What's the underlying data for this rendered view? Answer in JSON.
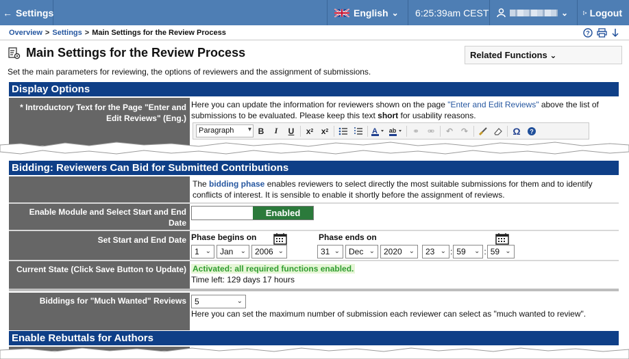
{
  "topbar": {
    "back_label": "Settings",
    "language": "English",
    "time": "6:25:39am",
    "timezone": "CEST",
    "logout_label": "Logout"
  },
  "breadcrumb": {
    "overview": "Overview",
    "settings": "Settings",
    "current": "Main Settings for the Review Process",
    "sep": ">"
  },
  "page": {
    "title": "Main Settings for the Review Process",
    "related_label": "Related Functions",
    "subtitle": "Set the main parameters for reviewing, the options of reviewers and the assignment of submissions."
  },
  "display_options": {
    "header": "Display Options",
    "intro_label": "* Introductory Text for the Page \"Enter and Edit Reviews\" (Eng.)",
    "intro_text_before": "Here you can update the information for reviewers shown on the page ",
    "intro_link": "\"Enter and Edit Reviews\"",
    "intro_text_middle": " above the list of submissions to be evaluated. Please keep this text ",
    "intro_bold": "short",
    "intro_text_after": " for usability reasons.",
    "editor_format": "Paragraph"
  },
  "bidding": {
    "header": "Bidding: Reviewers Can Bid for Submitted Contributions",
    "desc_before": "The ",
    "desc_link": "bidding phase",
    "desc_after": " enables reviewers to select directly the most suitable submissions for them and to identify conflicts of interest. It is sensible to enable it shortly before the assignment of reviews.",
    "enable_label": "Enable Module and Select Start and End Date",
    "enable_state": "Enabled",
    "dates_label": "Set Start and End Date",
    "begins_label": "Phase begins on",
    "ends_label": "Phase ends on",
    "begin": {
      "day": "1",
      "month": "Jan",
      "year": "2006"
    },
    "end": {
      "day": "31",
      "month": "Dec",
      "year": "2020",
      "hour": "23",
      "minute": "59",
      "second": "59"
    },
    "time_sep": ":",
    "state_label": "Current State (Click Save Button to Update)",
    "state_value": "Activated: all required functions enabled.",
    "time_left": "Time left: 129 days 17 hours",
    "much_wanted_label": "Biddings for \"Much Wanted\" Reviews",
    "much_wanted_value": "5",
    "much_wanted_help": "Here you can set the maximum number of submission each reviewer can select as \"much wanted to review\"."
  },
  "rebuttals": {
    "header": "Enable Rebuttals for Authors"
  },
  "colors": {
    "topbar": "#4e7eb4",
    "section_header": "#0f3f87",
    "label_bg": "#666666",
    "enabled_green": "#2b7a3b",
    "link_blue": "#2657a0"
  }
}
